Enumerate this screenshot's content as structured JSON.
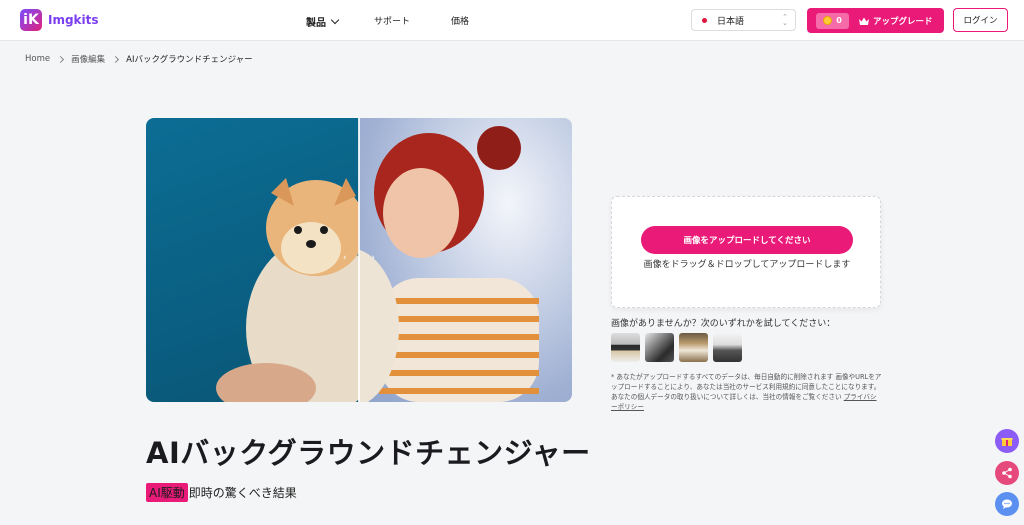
{
  "brand": {
    "logo_letter": "iK",
    "name": "Imgkits"
  },
  "nav": {
    "products": "製品",
    "support": "サポート",
    "price": "価格"
  },
  "language": {
    "label": "日本語",
    "caret": "⌃⌄"
  },
  "credits": {
    "count": "0",
    "upgrade_label": "アップグレード"
  },
  "login_label": "ログイン",
  "breadcrumb": {
    "home": "Home",
    "category": "画像編集",
    "current": "AIバックグラウンドチェンジャー"
  },
  "hero": {
    "handle_left": "‹",
    "handle_right": "›"
  },
  "page": {
    "title": "AIバックグラウンドチェンジャー",
    "badge": "AI駆動",
    "subtitle": "即時の驚くべき結果"
  },
  "upload": {
    "button_label": "画像をアップロードしてください",
    "hint": "画像をドラッグ＆ドロップしてアップロードします"
  },
  "samples": {
    "try_label": "画像がありませんか？次のいずれかを試してください："
  },
  "disclaimer": {
    "text": "* あなたがアップロードするすべてのデータは、毎日自動的に削除されます 画像やURLをアップロードすることにより、あなたは当社のサービス利用規約に同意したことになります。あなたの個人データの取り扱いについて詳しくは、当社の情報をご覧ください ",
    "link": "プライバシーポリシー"
  },
  "colors": {
    "accent": "#ea1a79",
    "brand": "#7a3ef0"
  }
}
